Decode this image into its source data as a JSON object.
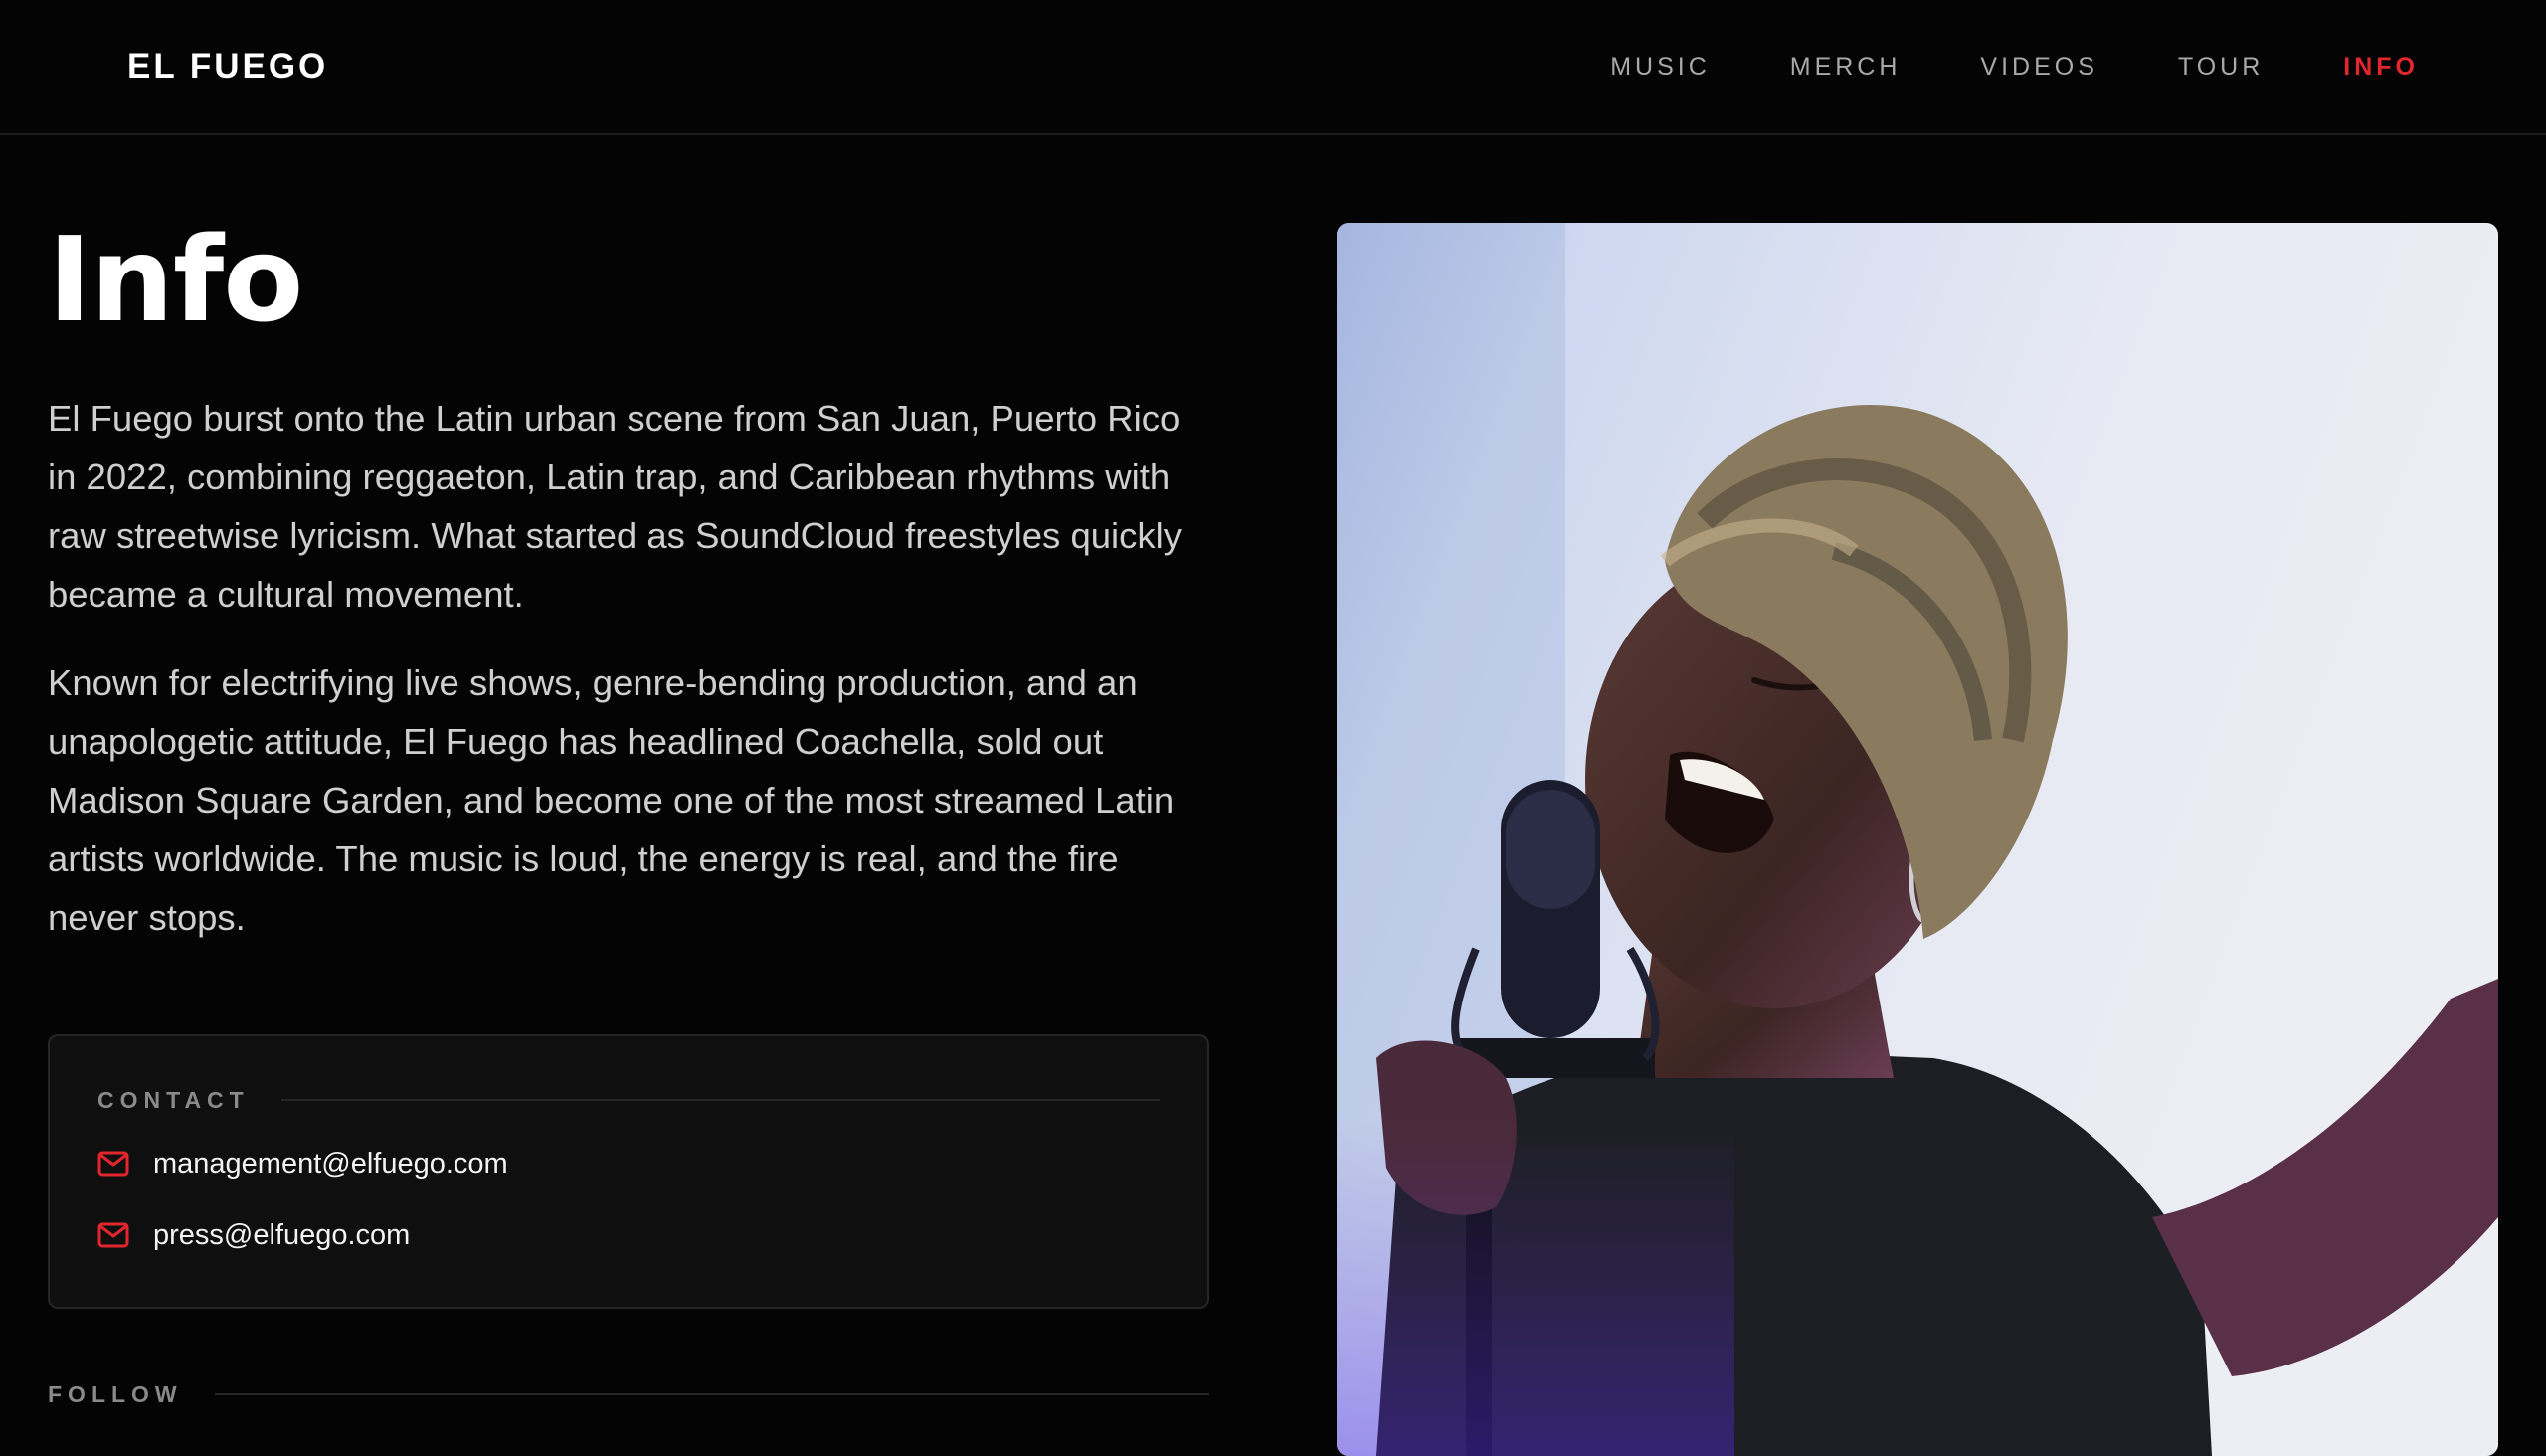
{
  "brand": {
    "name": "EL FUEGO"
  },
  "nav": {
    "items": [
      {
        "label": "MUSIC",
        "active": false
      },
      {
        "label": "MERCH",
        "active": false
      },
      {
        "label": "VIDEOS",
        "active": false
      },
      {
        "label": "TOUR",
        "active": false
      },
      {
        "label": "INFO",
        "active": true
      }
    ]
  },
  "page": {
    "title": "Info",
    "bio": [
      "El Fuego burst onto the Latin urban scene from San Juan, Puerto Rico in 2022, combining reggaeton, Latin trap, and Caribbean rhythms with raw streetwise lyricism. What started as SoundCloud freestyles quickly became a cultural movement.",
      "Known for electrifying live shows, genre-bending production, and an unapologetic attitude, El Fuego has headlined Coachella, sold out Madison Square Garden, and become one of the most streamed Latin artists worldwide. The music is loud, the energy is real, and the fire never stops."
    ]
  },
  "contact": {
    "label": "CONTACT",
    "emails": [
      {
        "icon": "mail-icon",
        "address": "management@elfuego.com"
      },
      {
        "icon": "mail-icon",
        "address": "press@elfuego.com"
      }
    ]
  },
  "follow": {
    "label": "FOLLOW"
  },
  "colors": {
    "background": "#040404",
    "accent": "#e1262e",
    "nav_text": "#a9a9a9",
    "body_text": "#cfcfcf",
    "card_bg": "#0f0f0f"
  }
}
